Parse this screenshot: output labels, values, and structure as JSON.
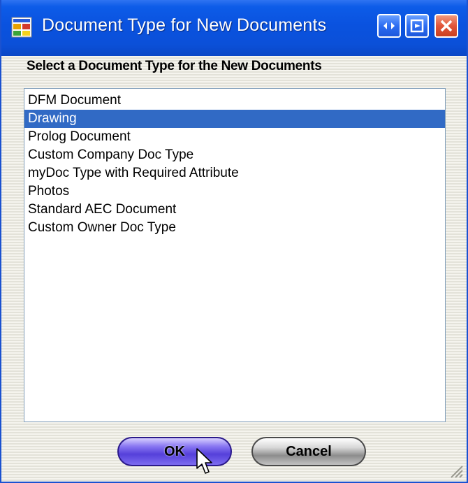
{
  "window": {
    "title": "Document Type for New Documents"
  },
  "heading": "Select a Document Type for the New Documents",
  "document_types": [
    "DFM Document",
    "Drawing",
    "Prolog Document",
    "Custom Company Doc Type",
    "myDoc Type with Required Attribute",
    "Photos",
    "Standard AEC Document",
    "Custom Owner Doc Type"
  ],
  "selected_document_type": "Drawing",
  "buttons": {
    "ok_label": "OK",
    "cancel_label": "Cancel"
  },
  "icons": {
    "app": "app-window-icon",
    "restore": "restore-icon",
    "minimize": "minimize-to-tray-icon",
    "close": "close-icon",
    "cursor": "mouse-pointer-icon",
    "grip": "resize-grip-icon"
  },
  "colors": {
    "titlebar": "#0a52df",
    "selection": "#316ac5",
    "ok_button": "#5540da",
    "close_button": "#e2553a"
  }
}
